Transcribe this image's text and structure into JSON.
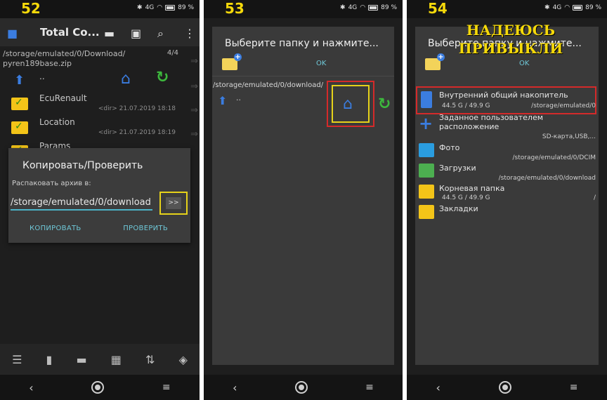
{
  "screens": [
    {
      "number": "52",
      "status": {
        "network": "4G",
        "battery": "89 %"
      },
      "app_title": "Total Co...",
      "path": "/storage/emulated/0/Download/",
      "file": "pyren189base.zip",
      "counter": "4/4",
      "up_label": "..",
      "rows": [
        {
          "name": "EcuRenault",
          "meta": "<dir> 21.07.2019 18:18"
        },
        {
          "name": "Location",
          "meta": "<dir> 21.07.2019 18:19"
        },
        {
          "name": "Params",
          "meta": ""
        }
      ],
      "dialog": {
        "title": "Копировать/Проверить",
        "label": "Распаковать архив в:",
        "value": "/storage/emulated/0/download",
        "arrow_btn": ">>",
        "copy_btn": "КОПИРОВАТЬ",
        "check_btn": "ПРОВЕРИТЬ"
      }
    },
    {
      "number": "53",
      "status": {
        "network": "4G",
        "battery": "89 %"
      },
      "dialog": {
        "title": "Выберите папку и нажмите...",
        "ok": "OK",
        "path": "/storage/emulated/0/download/",
        "up_label": ".."
      }
    },
    {
      "number": "54",
      "status": {
        "network": "4G",
        "battery": "89 %"
      },
      "note": "НАДЕЮСЬ ПРИВЫКЛИ",
      "dialog": {
        "title": "Выберите папку и нажмите...",
        "ok": "OK",
        "locations": [
          {
            "name": "Внутренний общий накопитель",
            "size": "44.5 G / 49.9 G",
            "path": "/storage/emulated/0",
            "icon": "sdcard-icon",
            "color": "#3b7de0"
          },
          {
            "name": "Заданное пользователем расположение",
            "size": "",
            "path": "SD-карта,USB,...",
            "icon": "plus-icon",
            "color": "#3b7de0"
          },
          {
            "name": "Фото",
            "size": "",
            "path": "/storage/emulated/0/DCIM",
            "icon": "photo-icon",
            "color": "#2a9de0"
          },
          {
            "name": "Загрузки",
            "size": "",
            "path": "/storage/emulated/0/download",
            "icon": "download-folder-icon",
            "color": "#4caf50"
          },
          {
            "name": "Корневая папка",
            "size": "44.5 G / 49.9 G",
            "path": "/",
            "icon": "folder-icon",
            "color": "#f3c418"
          },
          {
            "name": "Закладки",
            "size": "",
            "path": "",
            "icon": "bookmark-folder-icon",
            "color": "#f3c418"
          }
        ]
      }
    }
  ],
  "colors": {
    "accent": "#6fc8d8",
    "highlight_red": "#d42a2a",
    "highlight_yellow": "#e6d21a"
  }
}
